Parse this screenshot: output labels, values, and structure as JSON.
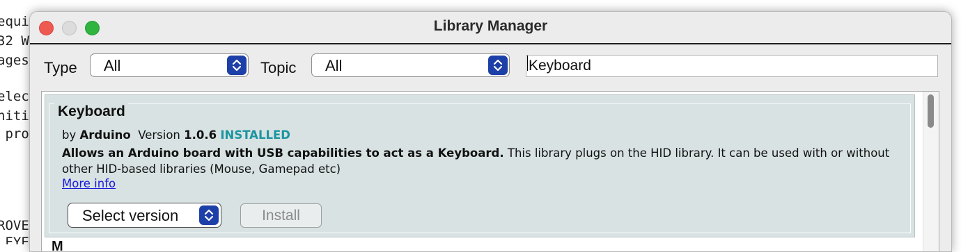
{
  "background_editor": {
    "lines": [
      "equi",
      "32 W",
      "ages",
      "",
      "elec",
      "niti",
      " pro",
      "",
      "",
      "",
      "ROVE",
      " EYE"
    ]
  },
  "window": {
    "title": "Library Manager"
  },
  "filters": {
    "type_label": "Type",
    "type_value": "All",
    "topic_label": "Topic",
    "topic_value": "All",
    "search_value": "Keyboard"
  },
  "library": {
    "name": "Keyboard",
    "by_prefix": "by",
    "author": "Arduino",
    "version_label": "Version",
    "version": "1.0.6",
    "status": "INSTALLED",
    "sentence": "Allows an Arduino board with USB capabilities to act as a Keyboard.",
    "paragraph": "This library plugs on the HID library. It can be used with or without other HID-based libraries (Mouse, Gamepad etc)",
    "more_info": "More info",
    "select_version": "Select version",
    "install": "Install"
  },
  "next_item": {
    "name_partial": "M"
  },
  "colors": {
    "accent_blue": "#1d3fa8",
    "installed_teal": "#1b95a1",
    "link_blue": "#1a1ad9",
    "item_background": "#d8e2e2"
  }
}
